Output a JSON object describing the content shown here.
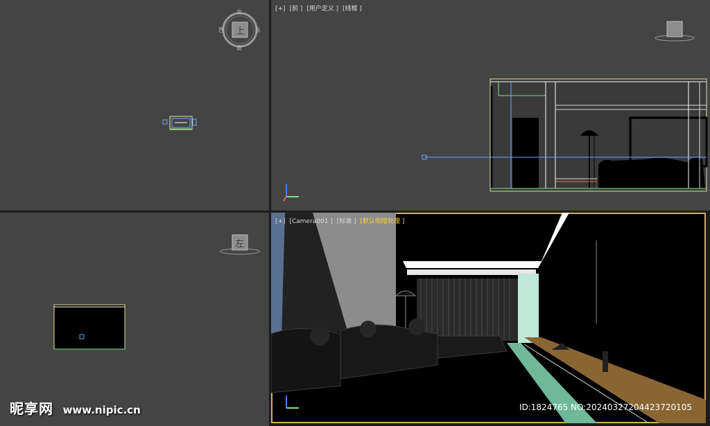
{
  "viewports": {
    "top": {
      "cube_label": "上",
      "compass": {
        "n": "北",
        "s": "南",
        "e": "东",
        "w": "西"
      }
    },
    "front": {
      "labels": [
        "[+]",
        "[前 ]",
        "[用户定义 ]",
        "[线框 ]"
      ],
      "cube_label": "前"
    },
    "left": {
      "cube_label": "左"
    },
    "camera": {
      "labels": [
        "[+]",
        "[Camera001 ]",
        "[标准 ]"
      ],
      "highlight_label": "[默认明暗处理 ]"
    }
  },
  "watermark": {
    "logo": "昵享网",
    "url": "www.nipic.cn",
    "id_text": "ID:1824765 NO:20240327204423720105"
  },
  "colors": {
    "viewport_bg": "#444444",
    "active_border": "#d6b24a",
    "highlight_label": "#ffd23a"
  }
}
